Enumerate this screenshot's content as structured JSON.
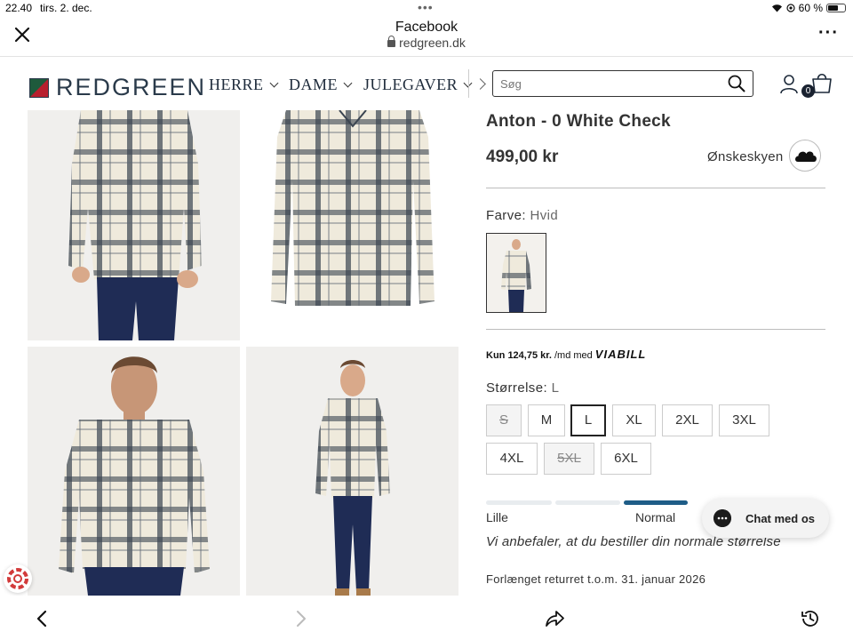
{
  "status_bar": {
    "time": "22.40",
    "date": "tirs. 2. dec.",
    "battery": "60 %",
    "battery_level": 0.6
  },
  "browser": {
    "title": "Facebook",
    "url": "redgreen.dk"
  },
  "site": {
    "logo_text": "REDGREEN",
    "nav": [
      {
        "label": "HERRE"
      },
      {
        "label": "DAME"
      },
      {
        "label": "JULEGAVER"
      }
    ],
    "search_placeholder": "Søg",
    "cart_count": "0"
  },
  "product": {
    "title": "Anton - 0 White Check",
    "price": "499,00 kr",
    "wishlist_label": "Ønskeskyen",
    "color_label": "Farve:",
    "color_value": "Hvid",
    "viabill": {
      "amount": "Kun 124,75 kr.",
      "suffix": "/md med",
      "brand": "VIABILL"
    },
    "size_label": "Størrelse:",
    "size_selected": "L",
    "sizes": [
      {
        "label": "S",
        "available": false
      },
      {
        "label": "M",
        "available": true
      },
      {
        "label": "L",
        "available": true
      },
      {
        "label": "XL",
        "available": true
      },
      {
        "label": "2XL",
        "available": true
      },
      {
        "label": "3XL",
        "available": true
      },
      {
        "label": "4XL",
        "available": true
      },
      {
        "label": "5XL",
        "available": false
      },
      {
        "label": "6XL",
        "available": true
      }
    ],
    "fit": {
      "low_label": "Lille",
      "mid_label": "Normal",
      "selected_segment": 2
    },
    "recommendation": "Vi anbefaler, at du bestiller din normale størrelse",
    "returns": "Forlænget returret t.o.m. 31. januar 2026"
  },
  "chat": {
    "label": "Chat med os"
  },
  "icons": {
    "close": "close-icon",
    "more": "more-icon",
    "search": "search-icon",
    "user": "user-icon",
    "cart": "cart-icon",
    "wishlist": "cloud-icon",
    "back": "back-arrow-icon",
    "forward": "forward-arrow-icon",
    "share": "share-icon",
    "history": "history-icon"
  },
  "colors": {
    "accent": "#1e5d87",
    "text": "#333333",
    "logo_red": "#b8202e",
    "logo_green": "#1e5a3c"
  }
}
